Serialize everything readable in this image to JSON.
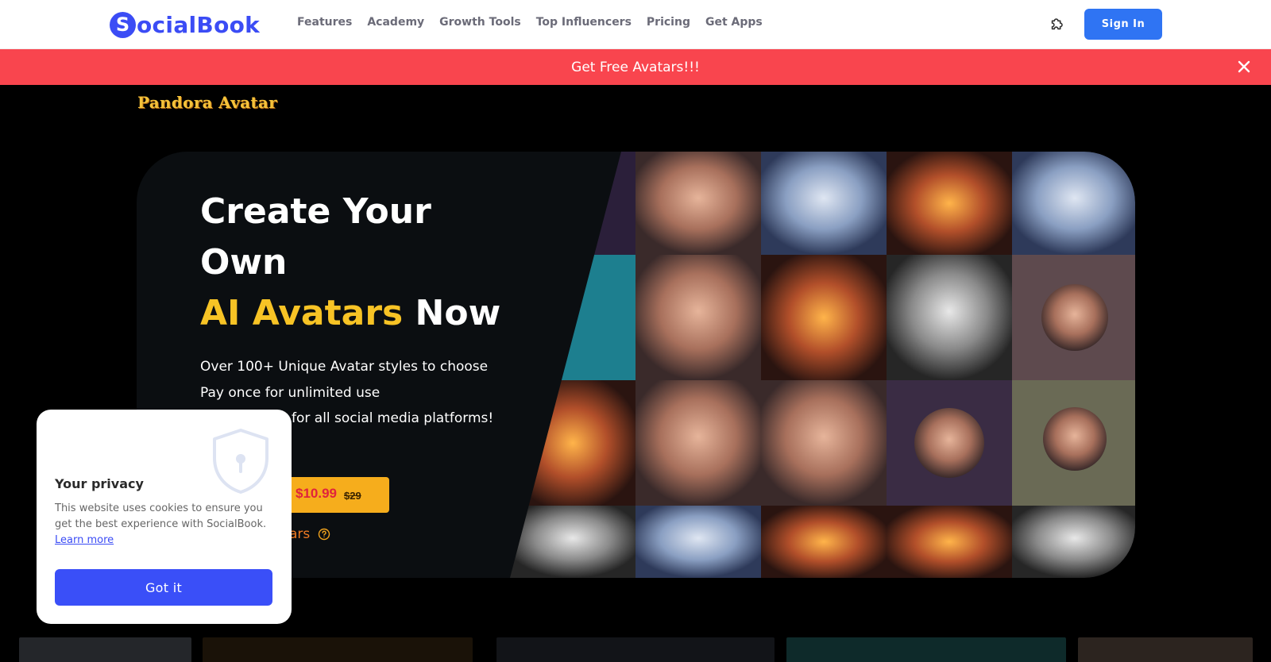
{
  "header": {
    "logo_mark": "S",
    "logo_text": "ocialBook",
    "nav": [
      {
        "label": "Features"
      },
      {
        "label": "Academy"
      },
      {
        "label": "Growth Tools"
      },
      {
        "label": "Top Influencers"
      },
      {
        "label": "Pricing"
      },
      {
        "label": "Get Apps"
      }
    ],
    "extension_icon": "puzzle-icon",
    "sign_in": "Sign In"
  },
  "promo": {
    "text": "Get Free Avatars!!!",
    "close_icon": "close-icon"
  },
  "brand": "Pandora Avatar",
  "hero": {
    "headline_line1": "Create Your",
    "headline_line2": "Own",
    "headline_accent": "AI Avatars",
    "headline_end": "Now",
    "features": [
      "Over 100+ Unique Avatar styles to choose",
      "Pay once for unlimited use",
      "for all social media platforms!"
    ],
    "cta_price": "$10.99",
    "cta_old_price": "$29",
    "free_link_partial": "ars",
    "gallery_image": "ai-avatar-portrait-grid"
  },
  "privacy": {
    "title": "Your privacy",
    "text": "This website uses cookies to ensure you get the best experience with SocialBook.",
    "link": "Learn more",
    "button": "Got it",
    "icon": "shield-lock-icon"
  },
  "colors": {
    "brand_blue": "#3b4cf5",
    "signin_blue": "#2f74f3",
    "promo_red": "#f9454e",
    "accent_yellow": "#f7c325",
    "cta_orange": "#f6ad1c",
    "price_red": "#e0233c"
  }
}
